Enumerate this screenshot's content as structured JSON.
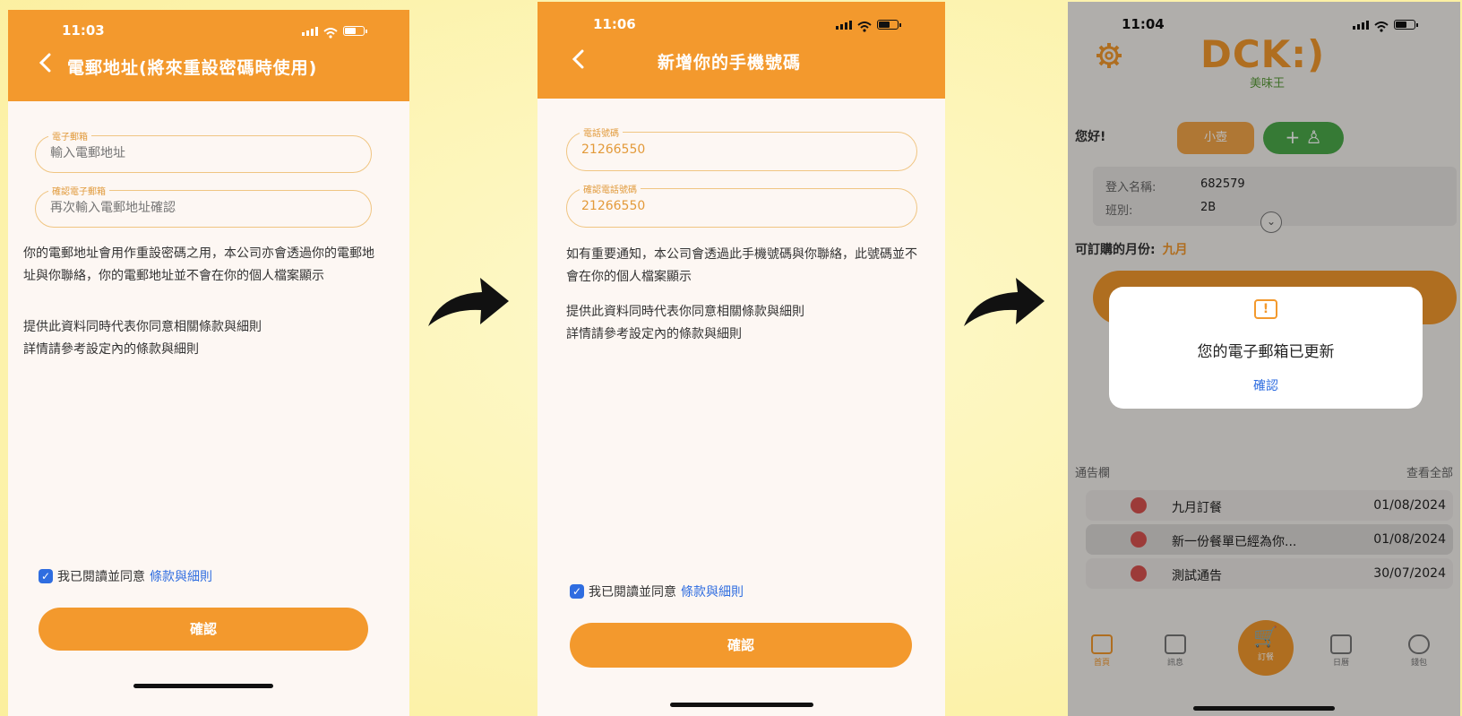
{
  "screen1": {
    "time": "11:03",
    "title": "電郵地址(將來重設密碼時使用)",
    "back_icon": "‹",
    "email_label": "電子郵箱",
    "email_placeholder": "輸入電郵地址",
    "confirm_label": "確認電子郵箱",
    "confirm_placeholder": "再次輸入電郵地址確認",
    "para1": "你的電郵地址會用作重設密碼之用，本公司亦會透過你的電郵地址與你聯絡，你的電郵地址並不會在你的個人檔案顯示",
    "para2_line1": "提供此資料同時代表你同意相關條款與細則",
    "para2_line2": "詳情請參考設定內的條款與細則",
    "agree_text": "我已閱讀並同意",
    "agree_link": "條款與細則",
    "confirm_button": "確認"
  },
  "screen2": {
    "time": "11:06",
    "title": "新增你的手機號碼",
    "back_icon": "‹",
    "phone_label": "電話號碼",
    "phone_value": "21266550",
    "confirm_label": "確認電話號碼",
    "confirm_value": "21266550",
    "para1": "如有重要通知，本公司會透過此手機號碼與你聯絡，此號碼並不會在你的個人檔案顯示",
    "para2_line1": "提供此資料同時代表你同意相關條款與細則",
    "para2_line2": "詳情請參考設定內的條款與細則",
    "agree_text": "我已閱讀並同意",
    "agree_link": "條款與細則",
    "confirm_button": "確認"
  },
  "screen3": {
    "time": "11:04",
    "logo": "DCK:)",
    "logo_sub": "美味王",
    "hello": "您好!",
    "pill_orange": "小壺",
    "pill_green": "+ ♙",
    "login_label": "登入名稱:",
    "login_value": "682579",
    "class_label": "班別:",
    "class_value": "2B",
    "month_label": "可訂購的月份:",
    "month_value": "九月",
    "dialog_icon": "!",
    "dialog_message": "您的電子郵箱已更新",
    "dialog_button": "確認",
    "notice_head": "通告欄",
    "notice_all": "查看全部",
    "notices": [
      {
        "title": "九月訂餐",
        "date": "01/08/2024"
      },
      {
        "title": "新一份餐單已經為你...",
        "date": "01/08/2024"
      },
      {
        "title": "測試通告",
        "date": "30/07/2024"
      }
    ],
    "tabs": [
      "首頁",
      "訊息",
      "訂餐",
      "日曆",
      "錢包"
    ],
    "cart_icon": "🛒"
  },
  "colors": {
    "brand_orange": "#f3992d",
    "link_blue": "#2f6de0",
    "green": "#4caa4a"
  }
}
